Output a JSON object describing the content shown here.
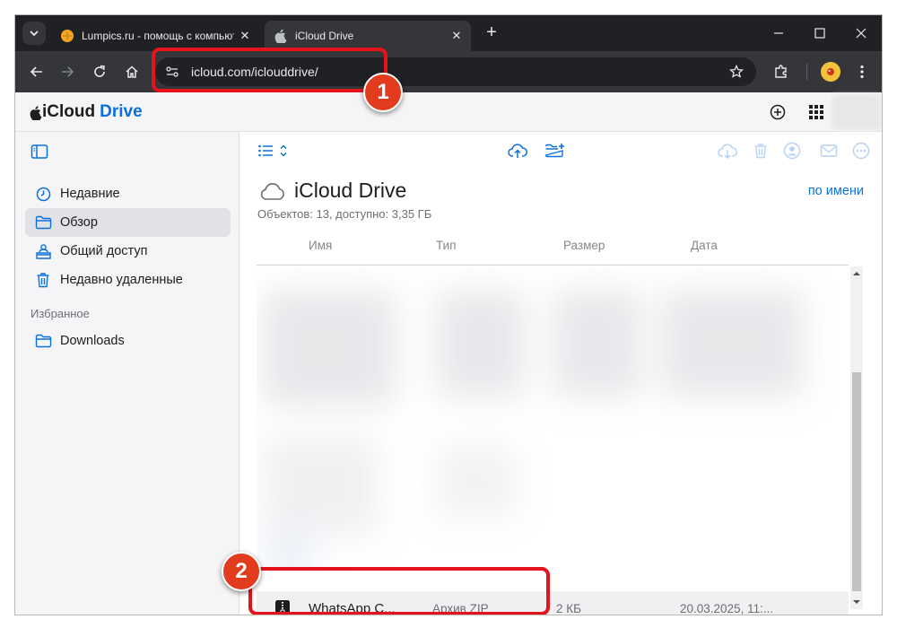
{
  "browser": {
    "tabs": [
      {
        "title": "Lumpics.ru - помощь с компьютером",
        "close": "✕"
      },
      {
        "title": "iCloud Drive",
        "close": "✕"
      }
    ],
    "new_tab": "+",
    "url": "icloud.com/iclouddrive/"
  },
  "header": {
    "brand": "iCloud",
    "product": "Drive"
  },
  "sidebar": {
    "items": [
      {
        "label": "Недавние",
        "icon": "clock-icon"
      },
      {
        "label": "Обзор",
        "icon": "folder-icon",
        "selected": true
      },
      {
        "label": "Общий доступ",
        "icon": "shared-folder-icon"
      },
      {
        "label": "Недавно удаленные",
        "icon": "trash-icon"
      }
    ],
    "favorites_heading": "Избранное",
    "favorites": [
      {
        "label": "Downloads",
        "icon": "folder-icon"
      }
    ]
  },
  "main": {
    "title": "iCloud Drive",
    "sort_label": "по имени",
    "summary": "Объектов: 13, доступно: 3,35 ГБ",
    "columns": [
      "Имя",
      "Тип",
      "Размер",
      "Дата"
    ],
    "files": [
      {
        "name": "WhatsApp C...",
        "type": "Архив ZIP",
        "size": "2 КБ",
        "date": "20.03.2025, 11:..."
      }
    ]
  },
  "annotations": [
    {
      "number": "1"
    },
    {
      "number": "2"
    }
  ],
  "colors": {
    "accent": "#0a70e0",
    "annotation": "#e5131b",
    "chrome_dark": "#202124"
  }
}
